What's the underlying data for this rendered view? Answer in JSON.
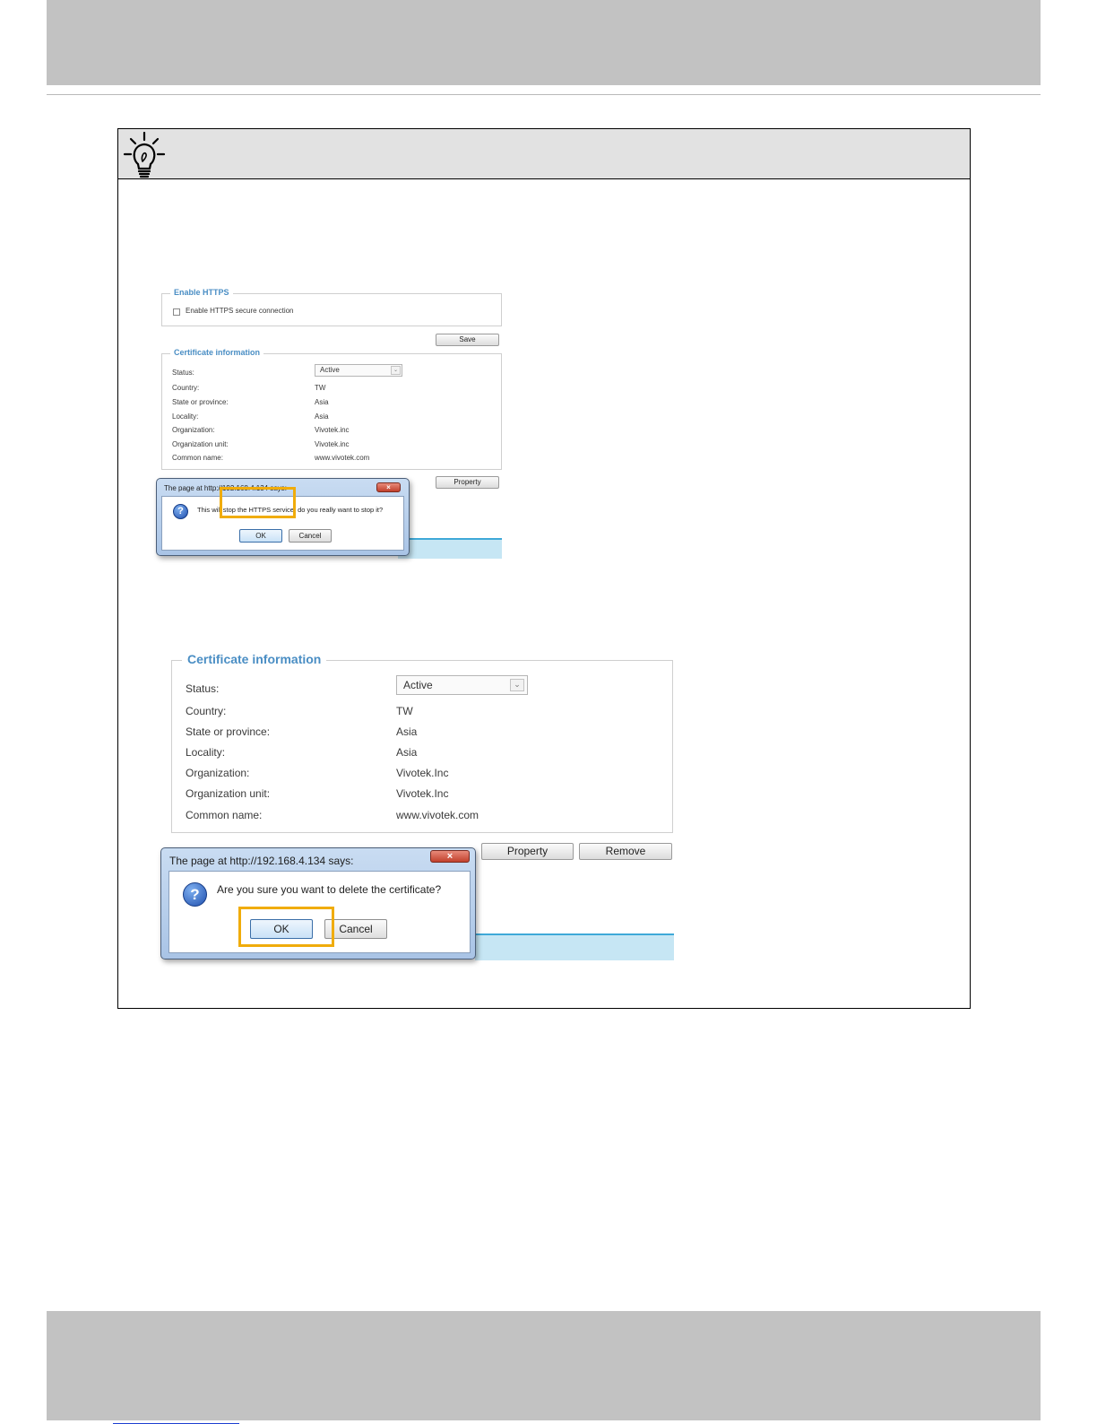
{
  "shot1": {
    "enable_legend": "Enable HTTPS",
    "enable_checkbox_label": "Enable HTTPS secure connection",
    "save_label": "Save",
    "cert_legend": "Certificate information",
    "rows": [
      {
        "label": "Status:",
        "value": "Active"
      },
      {
        "label": "Country:",
        "value": "TW"
      },
      {
        "label": "State or province:",
        "value": "Asia"
      },
      {
        "label": "Locality:",
        "value": "Asia"
      },
      {
        "label": "Organization:",
        "value": "Vivotek.inc"
      },
      {
        "label": "Organization unit:",
        "value": "Vivotek.inc"
      },
      {
        "label": "Common name:",
        "value": "www.vivotek.com"
      }
    ],
    "property_label": "Property",
    "dialog": {
      "title": "The page at http://192.168.4.134 says:",
      "message": "This will stop the HTTPS service, do you really want to stop it?",
      "ok": "OK",
      "cancel": "Cancel"
    }
  },
  "shot2": {
    "cert_legend": "Certificate information",
    "rows": [
      {
        "label": "Status:",
        "value": "Active"
      },
      {
        "label": "Country:",
        "value": "TW"
      },
      {
        "label": "State or province:",
        "value": "Asia"
      },
      {
        "label": "Locality:",
        "value": "Asia"
      },
      {
        "label": "Organization:",
        "value": "Vivotek.Inc"
      },
      {
        "label": "Organization unit:",
        "value": "Vivotek.Inc"
      },
      {
        "label": "Common name:",
        "value": "www.vivotek.com"
      }
    ],
    "property_label": "Property",
    "remove_label": "Remove",
    "dialog": {
      "title": "The page at http://192.168.4.134 says:",
      "message": "Are you sure you want to delete the certificate?",
      "ok": "OK",
      "cancel": "Cancel"
    }
  },
  "icons": {
    "tip": "lightbulb-icon",
    "question": "question-icon",
    "close": "close-icon",
    "dropdown": "chevron-down-icon"
  },
  "colors": {
    "band": "#c2c2c2",
    "tip_header": "#e2e2e2",
    "highlight": "#f0ac0b",
    "legend_blue": "#4a8ec4",
    "footer_link": "#1d3fd1"
  }
}
